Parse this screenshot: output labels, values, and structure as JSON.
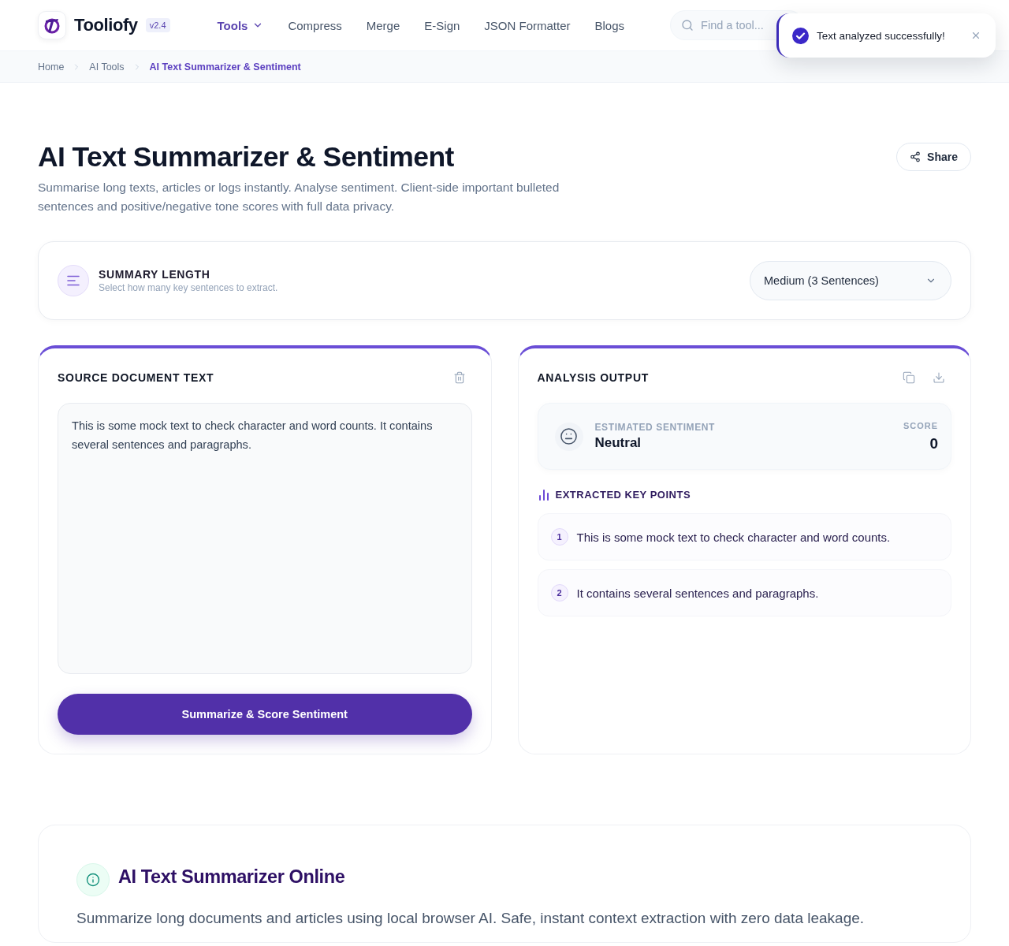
{
  "header": {
    "brand": "Tooliofy",
    "version": "v2.4",
    "nav": [
      {
        "label": "Tools",
        "selected": true,
        "dropdown": true
      },
      {
        "label": "Compress",
        "selected": false,
        "dropdown": false
      },
      {
        "label": "Merge",
        "selected": false,
        "dropdown": false
      },
      {
        "label": "E-Sign",
        "selected": false,
        "dropdown": false
      },
      {
        "label": "JSON Formatter",
        "selected": false,
        "dropdown": false
      },
      {
        "label": "Blogs",
        "selected": false,
        "dropdown": false
      }
    ],
    "search": {
      "placeholder": "Find a tool..."
    }
  },
  "toast": {
    "kind": "success",
    "message": "Text analyzed successfully!"
  },
  "breadcrumb": [
    {
      "label": "Home",
      "current": false
    },
    {
      "label": "AI Tools",
      "current": false
    },
    {
      "label": "AI Text Summarizer & Sentiment",
      "current": true
    }
  ],
  "page": {
    "title": "AI Text Summarizer & Sentiment",
    "subtitle": "Summarise long texts, articles or logs instantly. Analyse sentiment. Client-side important bulleted sentences and positive/negative tone scores with full data privacy.",
    "share_button": "Share"
  },
  "summary_length": {
    "label": "SUMMARY LENGTH",
    "hint": "Select how many key sentences to extract.",
    "value": "Medium (3 Sentences)"
  },
  "source_panel": {
    "title": "SOURCE DOCUMENT TEXT",
    "text": "This is some mock text to check character and word counts. It contains several sentences and paragraphs.",
    "button": "Summarize & Score Sentiment"
  },
  "output_panel": {
    "title": "ANALYSIS OUTPUT",
    "sentiment": {
      "label": "ESTIMATED SENTIMENT",
      "value": "Neutral",
      "score_label": "SCORE",
      "score": "0"
    },
    "key_points_title": "EXTRACTED KEY POINTS",
    "key_points": [
      {
        "number": "1",
        "text": "This is some mock text to check character and word counts."
      },
      {
        "number": "2",
        "text": "It contains several sentences and paragraphs."
      }
    ]
  },
  "about": {
    "title": "AI Text Summarizer Online",
    "text": "Summarize long documents and articles using local browser AI. Safe, instant context extraction with zero data leakage."
  }
}
